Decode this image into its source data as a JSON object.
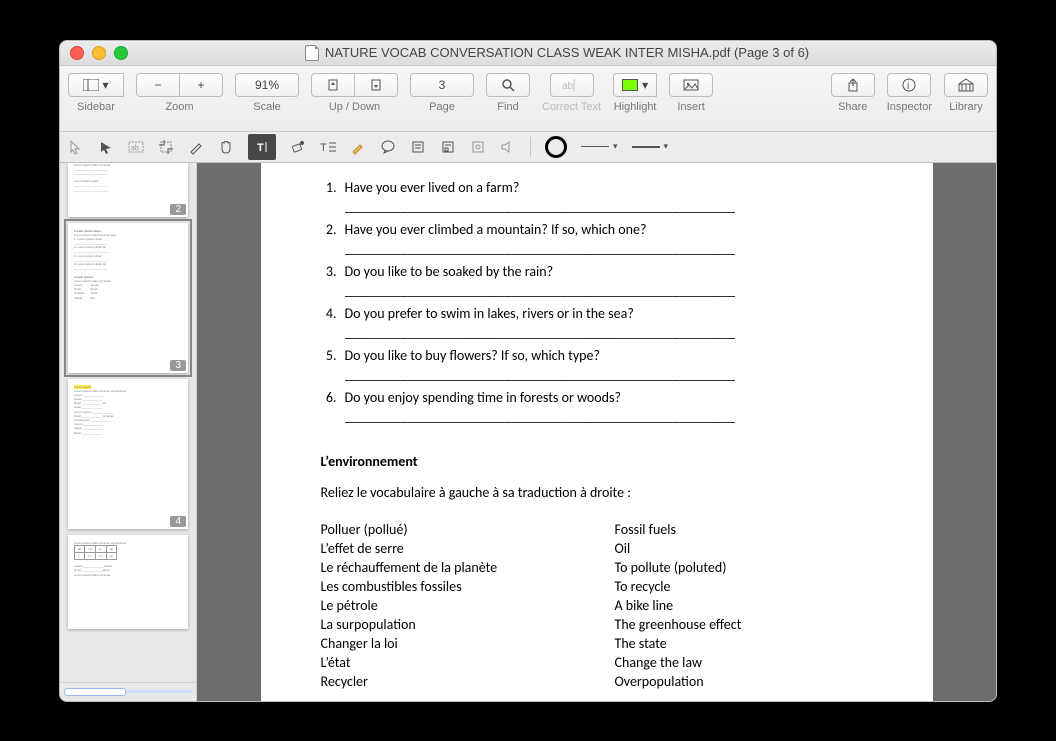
{
  "window": {
    "title": "NATURE VOCAB CONVERSATION CLASS WEAK INTER MISHA.pdf (Page 3 of 6)"
  },
  "toolbar": {
    "sidebar_label": "Sidebar",
    "zoom_label": "Zoom",
    "zoom_value": "91%",
    "scale_label": "Scale",
    "updown_label": "Up / Down",
    "page_label": "Page",
    "page_value": "3",
    "find_label": "Find",
    "correct_label": "Correct Text",
    "highlight_label": "Highlight",
    "insert_label": "Insert",
    "share_label": "Share",
    "inspector_label": "Inspector",
    "library_label": "Library",
    "minus": "−",
    "plus": "+"
  },
  "thumbs": {
    "p2": "2",
    "p3": "3",
    "p4": "4"
  },
  "doc": {
    "questions": [
      "Have you ever lived on a farm?",
      "Have you ever climbed a mountain? If so, which one?",
      "Do you like to be soaked by the rain?",
      "Do you prefer to swim in lakes, rivers or in the sea?",
      "Do you like to buy flowers? If so, which type?",
      "Do you enjoy spending time in forests or woods?"
    ],
    "blank": "________________________________________________________",
    "section": "L’environnement",
    "instruction": "Reliez le vocabulaire à gauche à sa traduction à droite :",
    "left": [
      "Polluer (pollué)",
      "L’effet de serre",
      "Le réchauffement de la planète",
      "Les combustibles fossiles",
      "Le pétrole",
      "La surpopulation",
      "Changer la loi",
      "L’état",
      "Recycler"
    ],
    "right": [
      "Fossil fuels",
      "Oil",
      "To pollute (poluted)",
      "To recycle",
      "A bike line",
      "The greenhouse effect",
      "The state",
      "Change the law",
      "Overpopulation"
    ]
  }
}
